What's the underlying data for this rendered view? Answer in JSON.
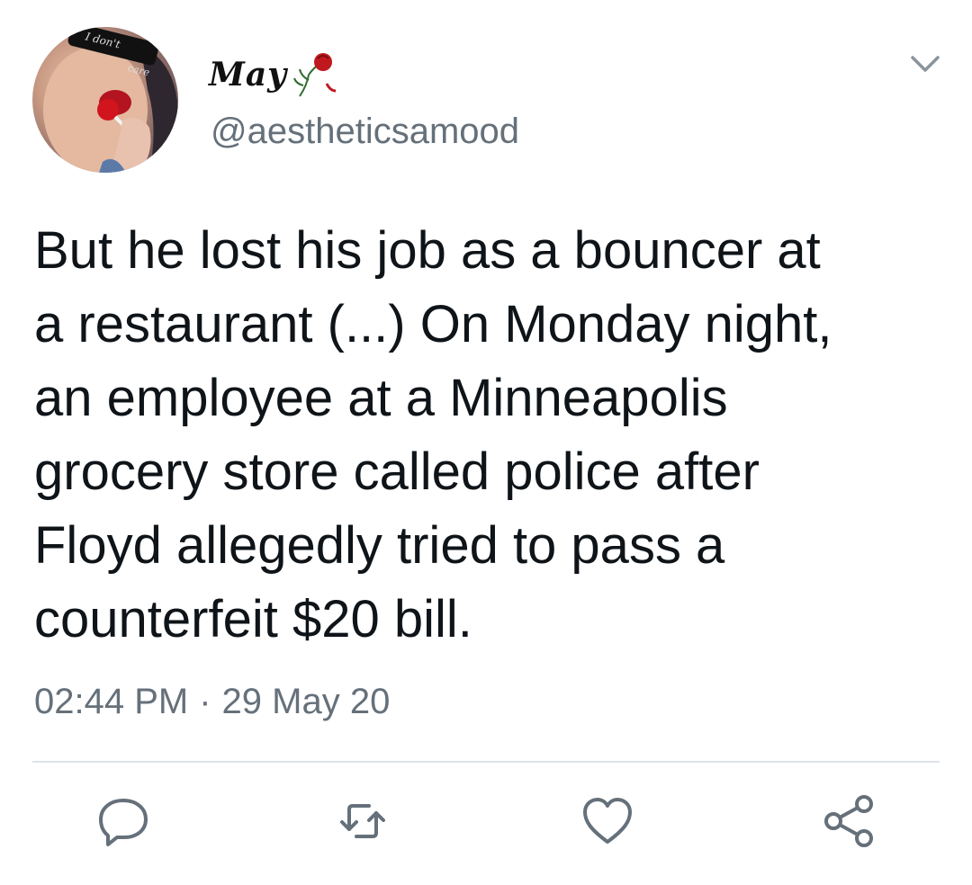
{
  "tweet": {
    "display_name": "May",
    "handle": "@aestheticsamood",
    "avatar_caption": "I don't care",
    "text": "But he lost his job as a bouncer at\na restaurant (...) On Monday night,\nan employee at a Minneapolis\ngrocery store called police after\nFloyd allegedly tried to pass a\ncounterfeit $20 bill.",
    "time": "02:44 PM",
    "separator": "·",
    "date": "29 May 20"
  },
  "actions": [
    {
      "name": "reply",
      "icon": "speech-bubble-icon"
    },
    {
      "name": "retweet",
      "icon": "retweet-icon"
    },
    {
      "name": "like",
      "icon": "heart-icon"
    },
    {
      "name": "share",
      "icon": "share-icon"
    }
  ],
  "colors": {
    "text": "#0f1419",
    "secondary": "#65707a",
    "divider": "#dde3e8",
    "icon": "#65707a"
  }
}
